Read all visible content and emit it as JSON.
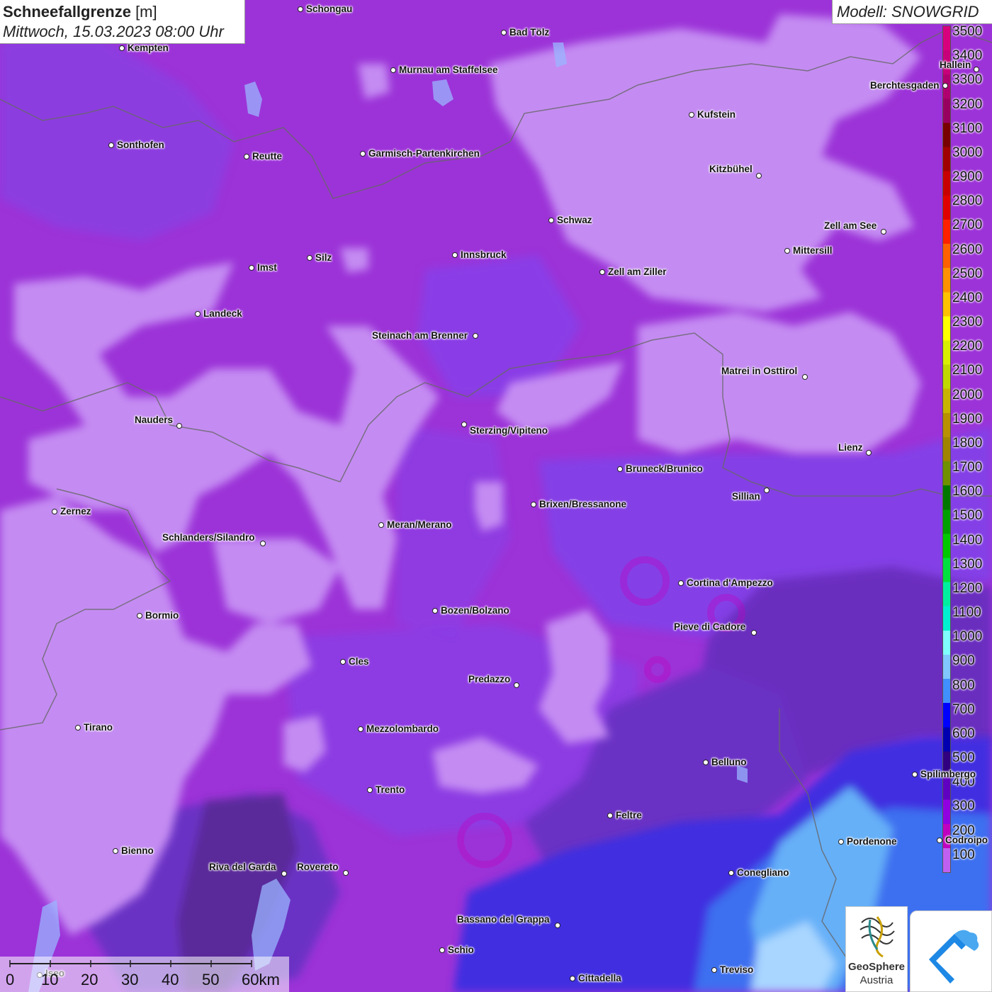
{
  "header": {
    "title_bold": "Schneefallgrenze",
    "title_unit": " [m]",
    "datetime": "Mittwoch, 15.03.2023 08:00 Uhr"
  },
  "model": {
    "label": "Modell: SNOWGRID"
  },
  "legend": {
    "entries": [
      {
        "value": "3500",
        "color": "#d8007c"
      },
      {
        "value": "3400",
        "color": "#c8007a"
      },
      {
        "value": "3300",
        "color": "#b00070"
      },
      {
        "value": "3200",
        "color": "#980060"
      },
      {
        "value": "3100",
        "color": "#780000"
      },
      {
        "value": "3000",
        "color": "#a00000"
      },
      {
        "value": "2900",
        "color": "#c80000"
      },
      {
        "value": "2800",
        "color": "#e00000"
      },
      {
        "value": "2700",
        "color": "#ff2000"
      },
      {
        "value": "2600",
        "color": "#ff6000"
      },
      {
        "value": "2500",
        "color": "#ff9000"
      },
      {
        "value": "2400",
        "color": "#ffc000"
      },
      {
        "value": "2300",
        "color": "#ffff00"
      },
      {
        "value": "2200",
        "color": "#d8f000"
      },
      {
        "value": "2100",
        "color": "#c0d800"
      },
      {
        "value": "2000",
        "color": "#c8b400"
      },
      {
        "value": "1900",
        "color": "#b89000"
      },
      {
        "value": "1800",
        "color": "#a08400"
      },
      {
        "value": "1700",
        "color": "#709000"
      },
      {
        "value": "1600",
        "color": "#007800"
      },
      {
        "value": "1500",
        "color": "#00a000"
      },
      {
        "value": "1400",
        "color": "#00c800"
      },
      {
        "value": "1300",
        "color": "#00e040"
      },
      {
        "value": "1200",
        "color": "#00f0a0"
      },
      {
        "value": "1100",
        "color": "#00f0d0"
      },
      {
        "value": "1000",
        "color": "#80ffff"
      },
      {
        "value": "900",
        "color": "#80c8ff"
      },
      {
        "value": "800",
        "color": "#4090ff"
      },
      {
        "value": "700",
        "color": "#0000ff"
      },
      {
        "value": "600",
        "color": "#0000b0"
      },
      {
        "value": "500",
        "color": "#300080"
      },
      {
        "value": "400",
        "color": "#6000c0"
      },
      {
        "value": "300",
        "color": "#9000e0"
      },
      {
        "value": "200",
        "color": "#c000c0"
      },
      {
        "value": "100",
        "color": "#c060f0"
      }
    ]
  },
  "cities": [
    {
      "name": "Schongau"
    },
    {
      "name": "Bad Tölz"
    },
    {
      "name": "Kempten"
    },
    {
      "name": "Murnau am Staffelsee"
    },
    {
      "name": "Hallein"
    },
    {
      "name": "Berchtesgaden"
    },
    {
      "name": "Kufstein"
    },
    {
      "name": "Sonthofen"
    },
    {
      "name": "Reutte"
    },
    {
      "name": "Garmisch-Partenkirchen"
    },
    {
      "name": "Kitzbühel"
    },
    {
      "name": "Schwaz"
    },
    {
      "name": "Zell am See"
    },
    {
      "name": "Mittersill"
    },
    {
      "name": "Innsbruck"
    },
    {
      "name": "Imst"
    },
    {
      "name": "Silz"
    },
    {
      "name": "Zell am Ziller"
    },
    {
      "name": "Landeck"
    },
    {
      "name": "Steinach am Brenner"
    },
    {
      "name": "Matrei in Osttirol"
    },
    {
      "name": "Nauders"
    },
    {
      "name": "Sterzing/Vipiteno"
    },
    {
      "name": "Lienz"
    },
    {
      "name": "Bruneck/Brunico"
    },
    {
      "name": "Sillian"
    },
    {
      "name": "Zernez"
    },
    {
      "name": "Brixen/Bressanone"
    },
    {
      "name": "Meran/Merano"
    },
    {
      "name": "Schlanders/Silandro"
    },
    {
      "name": "Cortina d'Ampezzo"
    },
    {
      "name": "Bozen/Bolzano"
    },
    {
      "name": "Bormio"
    },
    {
      "name": "Pieve di Cadore"
    },
    {
      "name": "Cles"
    },
    {
      "name": "Predazzo"
    },
    {
      "name": "Tirano"
    },
    {
      "name": "Mezzolombardo"
    },
    {
      "name": "Belluno"
    },
    {
      "name": "Spilimbergo"
    },
    {
      "name": "Trento"
    },
    {
      "name": "Feltre"
    },
    {
      "name": "Pordenone"
    },
    {
      "name": "Codroipo"
    },
    {
      "name": "Bienno"
    },
    {
      "name": "Riva del Garda"
    },
    {
      "name": "Rovereto"
    },
    {
      "name": "Conegliano"
    },
    {
      "name": "Bassano del Grappa"
    },
    {
      "name": "Schio"
    },
    {
      "name": "Treviso"
    },
    {
      "name": "Cittadella"
    },
    {
      "name": "Iseo"
    }
  ],
  "scale": {
    "ticks": [
      "0",
      "10",
      "20",
      "30",
      "40",
      "50",
      "60km"
    ]
  },
  "logos": {
    "geosphere_line1": "GeoSphere",
    "geosphere_line2": "Austria"
  }
}
